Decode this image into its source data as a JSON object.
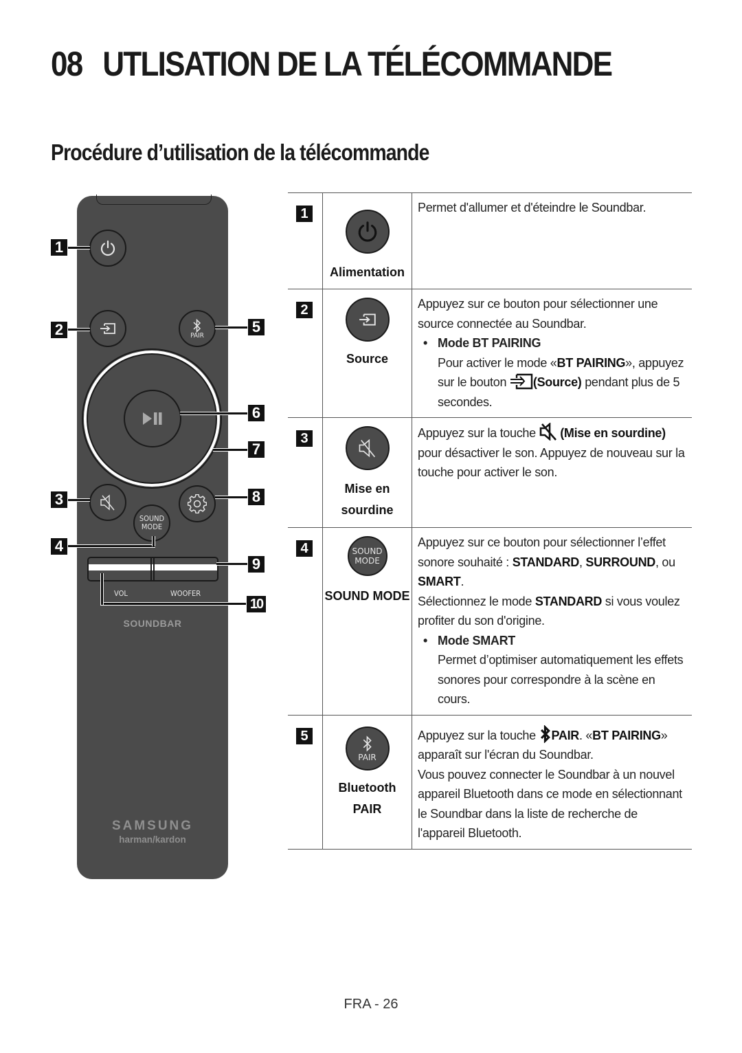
{
  "header": {
    "chapter_number": "08",
    "chapter_title": "UTLISATION DE LA TÉLÉCOMMANDE",
    "section_title": "Procédure d’utilisation de la télécommande"
  },
  "remote": {
    "callouts": [
      "1",
      "2",
      "3",
      "4",
      "5",
      "6",
      "7",
      "8",
      "9",
      "10"
    ],
    "pair_label": "PAIR",
    "sound_mode_line1": "SOUND",
    "sound_mode_line2": "MODE",
    "vol_label": "VOL",
    "woofer_label": "WOOFER",
    "soundbar_label": "SOUNDBAR",
    "brand": "SAMSUNG",
    "sub_brand": "harman/kardon",
    "icons": [
      "power-icon",
      "source-icon",
      "bluetooth-icon",
      "play-pause-icon",
      "mute-icon",
      "settings-icon"
    ]
  },
  "table": {
    "rows": [
      {
        "number": "1",
        "icon": "power-icon",
        "label": "Alimentation",
        "description": "Permet d'allumer et d'éteindre le Soundbar."
      },
      {
        "number": "2",
        "icon": "source-icon",
        "label": "Source",
        "description_intro": "Appuyez sur ce bouton pour sélectionner une source connectée au Soundbar.",
        "bullet_title": "Mode BT PAIRING",
        "bullet_text_1": "Pour activer le mode «",
        "bullet_bold_1": "BT PAIRING",
        "bullet_text_2": "», appuyez sur le bouton ",
        "bullet_bold_2": "(Source)",
        "bullet_text_3": " pendant plus de 5 secondes."
      },
      {
        "number": "3",
        "icon": "mute-icon",
        "label_line1": "Mise en",
        "label_line2": "sourdine",
        "text_1": "Appuyez sur la touche ",
        "bold_1": "(Mise en sourdine)",
        "text_2": " pour désactiver le son. Appuyez de nouveau sur la touche pour activer le son."
      },
      {
        "number": "4",
        "icon_line1": "SOUND",
        "icon_line2": "MODE",
        "label": "SOUND MODE",
        "text_1": "Appuyez sur ce bouton pour sélectionner l’effet sonore souhaité : ",
        "bold_1": "STANDARD",
        "text_2": ", ",
        "bold_2": "SURROUND",
        "text_3": ", ou ",
        "bold_3": "SMART",
        "text_4": ".",
        "text_5": "Sélectionnez le mode ",
        "bold_4": "STANDARD",
        "text_6": " si vous voulez profiter du son d'origine.",
        "bullet_title": "Mode SMART",
        "bullet_text": "Permet d’optimiser automatiquement les effets sonores pour correspondre à la scène en cours."
      },
      {
        "number": "5",
        "icon": "bluetooth-icon",
        "icon_text": "PAIR",
        "label_line1": "Bluetooth",
        "label_line2": "PAIR",
        "text_1": "Appuyez sur la touche ",
        "bold_1": "PAIR",
        "text_2": ". «",
        "bold_2": "BT PAIRING",
        "text_3": "» apparaît sur l'écran du Soundbar.",
        "text_4": "Vous pouvez connecter le Soundbar à un nouvel appareil Bluetooth dans ce mode en sélectionnant le Soundbar dans la liste de recherche de l'appareil Bluetooth."
      }
    ]
  },
  "footer": {
    "page_label": "FRA - 26"
  }
}
